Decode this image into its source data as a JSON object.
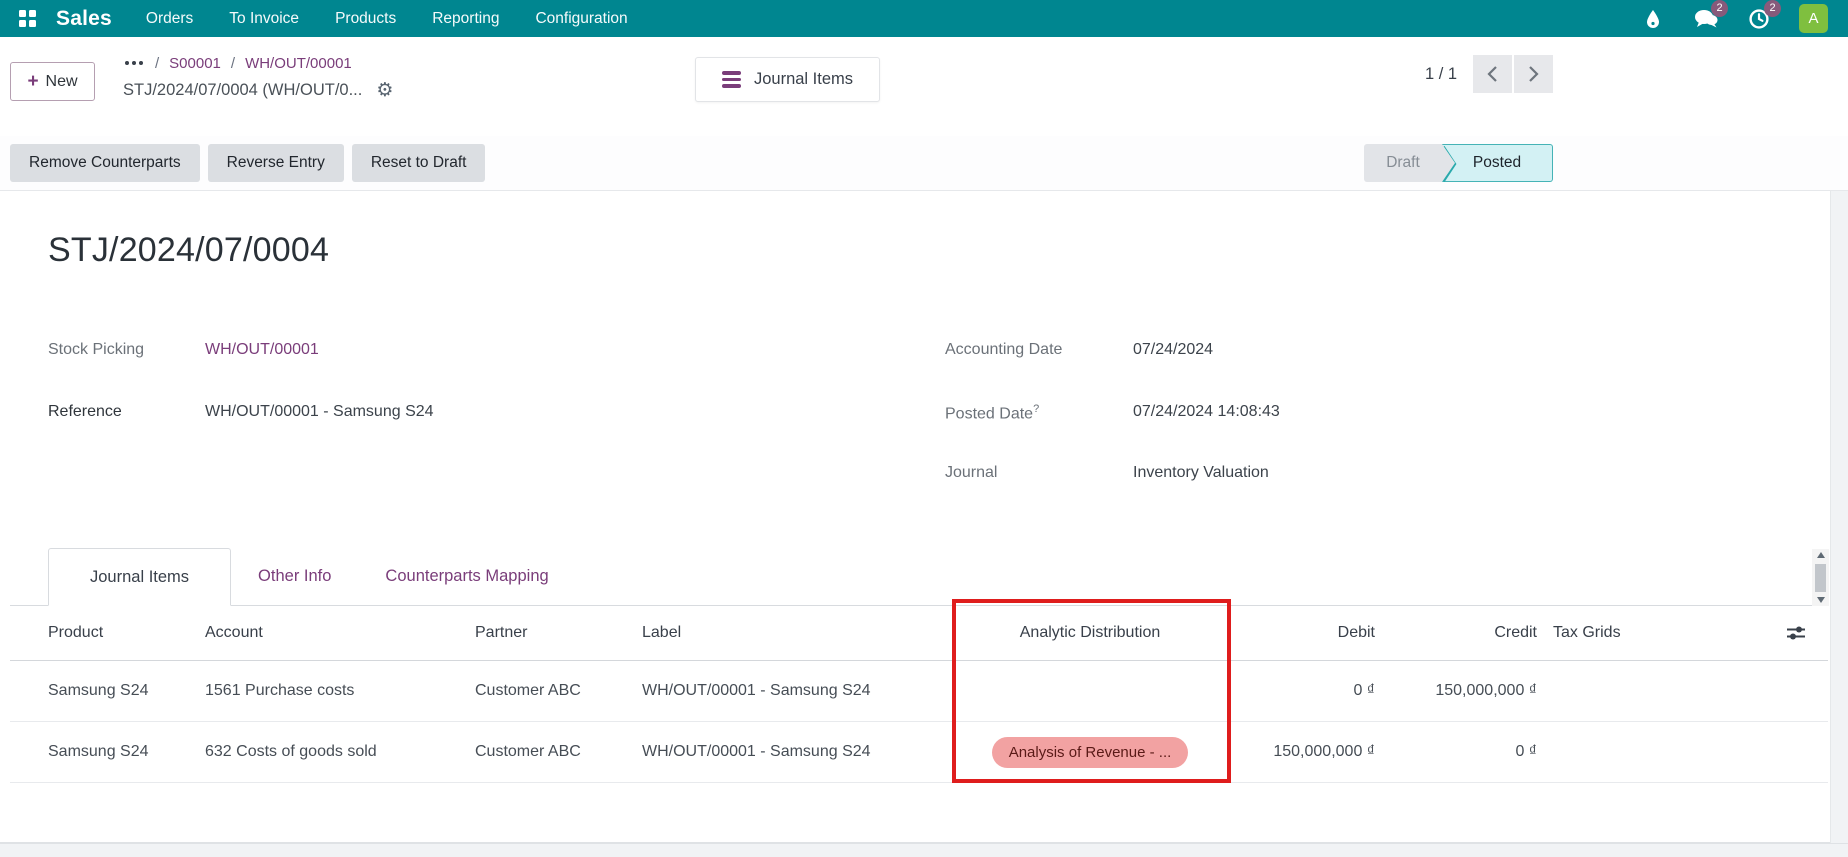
{
  "nav": {
    "app_name": "Sales",
    "menus": [
      "Orders",
      "To Invoice",
      "Products",
      "Reporting",
      "Configuration"
    ],
    "right": {
      "messages_badge": "2",
      "activities_badge": "2",
      "avatar_letter": "A",
      "icon_names": [
        "water-drop-icon",
        "messages-icon",
        "activities-clock-icon",
        "avatar"
      ]
    },
    "colors": {
      "bar": "#008690",
      "badge": "#875a7b",
      "avatar": "#7fbf3f"
    }
  },
  "control_panel": {
    "new_button": "New",
    "breadcrumb": {
      "ellipsis_menu": "breadcrumb-ellipsis",
      "items": [
        "S00001",
        "WH/OUT/00001"
      ],
      "separator": "/",
      "current": "STJ/2024/07/0004 (WH/OUT/0...",
      "gear_icon": "⚙"
    },
    "journal_items_button": "Journal Items",
    "pager": {
      "count": "1 / 1"
    }
  },
  "actionbar": {
    "buttons": [
      "Remove Counterparts",
      "Reverse Entry",
      "Reset to Draft"
    ],
    "states": [
      {
        "label": "Draft",
        "active": false
      },
      {
        "label": "Posted",
        "active": true
      }
    ],
    "posted_colors": {
      "bg": "#d3f1f4",
      "arrow": "#2aa9ac"
    }
  },
  "form": {
    "title": "STJ/2024/07/0004",
    "fields_left": [
      {
        "label": "Stock Picking",
        "value": "WH/OUT/00001"
      },
      {
        "label": "Reference",
        "value": "WH/OUT/00001 - Samsung S24"
      }
    ],
    "fields_right": [
      {
        "label": "Accounting Date",
        "value": "07/24/2024"
      },
      {
        "label": "Posted Date",
        "sup": "?",
        "value": "07/24/2024 14:08:43"
      },
      {
        "label": "Journal",
        "value": "Inventory Valuation"
      }
    ],
    "tabs": [
      {
        "label": "Journal Items",
        "active": true
      },
      {
        "label": "Other Info",
        "active": false
      },
      {
        "label": "Counterparts Mapping",
        "active": false
      }
    ]
  },
  "table": {
    "columns": [
      "Product",
      "Account",
      "Partner",
      "Label",
      "Analytic Distribution",
      "Debit",
      "Credit",
      "Tax Grids"
    ],
    "settings_icon": "column-sliders-icon",
    "rows": [
      {
        "product": "Samsung S24",
        "account": "1561 Purchase costs",
        "partner": "Customer ABC",
        "label": "WH/OUT/00001 - Samsung S24",
        "analytic": "",
        "debit": "0 ₫",
        "credit": "150,000,000 ₫",
        "tax_grids": ""
      },
      {
        "product": "Samsung S24",
        "account": "632 Costs of goods sold",
        "partner": "Customer ABC",
        "label": "WH/OUT/00001 - Samsung S24",
        "analytic": "Analysis of Revenue - ...",
        "debit": "150,000,000 ₫",
        "credit": "0 ₫",
        "tax_grids": ""
      }
    ],
    "analytic_tag_colors": {
      "bg": "#f2a2a2",
      "text": "#5a1a17"
    }
  },
  "annotation": {
    "highlight_box_color": "#df1d1d"
  }
}
